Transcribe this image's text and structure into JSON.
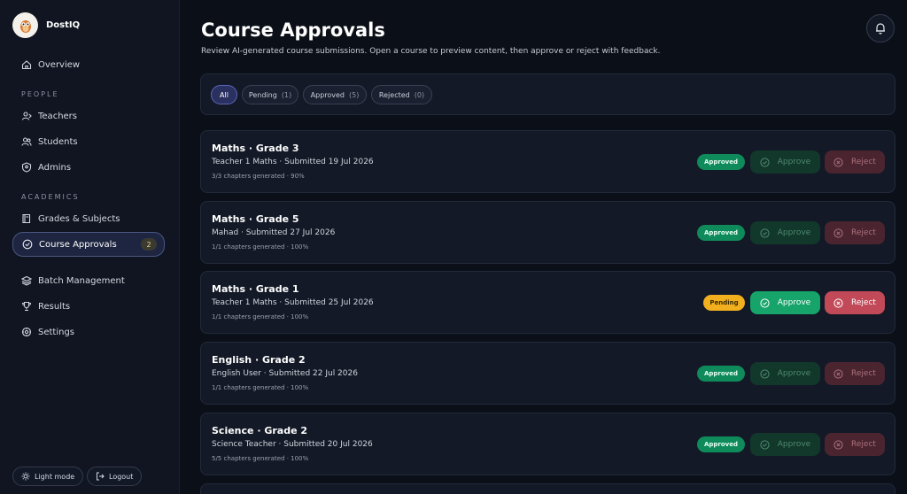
{
  "app": {
    "name": "DostIQ"
  },
  "sidebar": {
    "overview": "Overview",
    "people_label": "PEOPLE",
    "people": [
      "Teachers",
      "Students",
      "Admins"
    ],
    "academics_label": "ACADEMICS",
    "academics": [
      "Grades & Subjects",
      "Course Approvals"
    ],
    "course_approvals_badge": "2",
    "more": [
      "Batch Management",
      "Results",
      "Settings"
    ],
    "light_mode": "Light mode",
    "logout": "Logout"
  },
  "header": {
    "title": "Course Approvals",
    "subtitle": "Review AI-generated course submissions. Open a course to preview content, then approve or reject with feedback."
  },
  "filters": [
    {
      "label": "All",
      "count": ""
    },
    {
      "label": "Pending",
      "count": "(1)"
    },
    {
      "label": "Approved",
      "count": "(5)"
    },
    {
      "label": "Rejected",
      "count": "(0)"
    }
  ],
  "actions": {
    "approve": "Approve",
    "reject": "Reject"
  },
  "courses": [
    {
      "title": "Maths · Grade 3",
      "meta": "Teacher 1 Maths · Submitted 19 Jul 2026",
      "progress": "3/3 chapters generated · 90%",
      "status": "Approved"
    },
    {
      "title": "Maths · Grade 5",
      "meta": "Mahad · Submitted 27 Jul 2026",
      "progress": "1/1 chapters generated · 100%",
      "status": "Approved"
    },
    {
      "title": "Maths · Grade 1",
      "meta": "Teacher 1 Maths · Submitted 25 Jul 2026",
      "progress": "1/1 chapters generated · 100%",
      "status": "Pending"
    },
    {
      "title": "English · Grade 2",
      "meta": "English User · Submitted 22 Jul 2026",
      "progress": "1/1 chapters generated · 100%",
      "status": "Approved"
    },
    {
      "title": "Science · Grade 2",
      "meta": "Science Teacher · Submitted 20 Jul 2026",
      "progress": "5/5 chapters generated · 100%",
      "status": "Approved"
    }
  ],
  "icons": [
    "owl-logo-icon",
    "home-icon",
    "teachers-icon",
    "students-icon",
    "admins-icon",
    "book-icon",
    "check-circle-icon",
    "layers-icon",
    "trophy-icon",
    "settings-icon",
    "sun-icon",
    "logout-icon",
    "bell-icon",
    "x-circle-icon"
  ],
  "colors": {
    "accent": "#5a66b8",
    "approve": "#16a46a",
    "reject": "#c24a58",
    "pending": "#f2b01e",
    "approved_badge": "#0f8a5a"
  }
}
